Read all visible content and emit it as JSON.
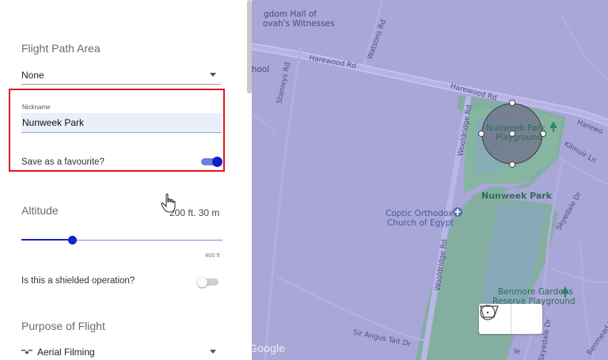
{
  "map": {
    "labels": {
      "hall_line1": "gdom Hall of",
      "hall_line2": "ovah's Witnesses",
      "school": "chool",
      "harewood_rd_left": "Harewood Rd",
      "harewood_rd_mid": "Harewood Rd",
      "harewood_right": "Harewo",
      "watsons_rd": "Watsons Rd",
      "stanleys_rd": "Stanleys Rd",
      "wooldridge_rd_top": "Wooldridge Rd",
      "wooldridge_rd_bottom": "Wooldridge Rd",
      "kilmuir_ln": "Kilmuir Ln",
      "skyedale_dr_top": "Skyedale Dr",
      "skyedale_dr_mid": "Skyedale Dr",
      "sir_angus_tait_dr": "Sir Angus Tait Dr",
      "benmead_dr": "Benmead Dr",
      "le": "le",
      "e": "e",
      "playground_line1": "Nunweek Park",
      "playground_line2": "Playground",
      "park": "Nunweek Park",
      "church_line1": "Coptic Orthodox",
      "church_line2": "Church of Egypt",
      "benmore_line1": "Benmore Gardens",
      "benmore_line2": "Reserve Playground"
    },
    "attribution": "Google",
    "tools": {
      "circle_icon": "circle-draw-icon",
      "polygon_icon": "polygon-draw-icon"
    }
  },
  "panel": {
    "flight_path": {
      "title": "Flight Path Area",
      "selected": "None"
    },
    "nickname": {
      "label": "Nickname",
      "value": "Nunweek Park",
      "favourite_label": "Save as a favourite?",
      "favourite_on": true
    },
    "altitude": {
      "title": "Altitude",
      "value_text": "200 ft. 30 m",
      "max_label": "400 ft",
      "value_ft": 100,
      "max_ft": 400
    },
    "shielded": {
      "label": "Is this a shielded operation?",
      "on": false
    },
    "purpose": {
      "title": "Purpose of Flight",
      "selected": "Aerial Filming",
      "icon": "drone-icon"
    }
  },
  "colors": {
    "map_base": "#a9a6d8",
    "park_green": "#7fb09a",
    "accent_blue": "#1126c4",
    "highlight_red": "#e0121f"
  }
}
